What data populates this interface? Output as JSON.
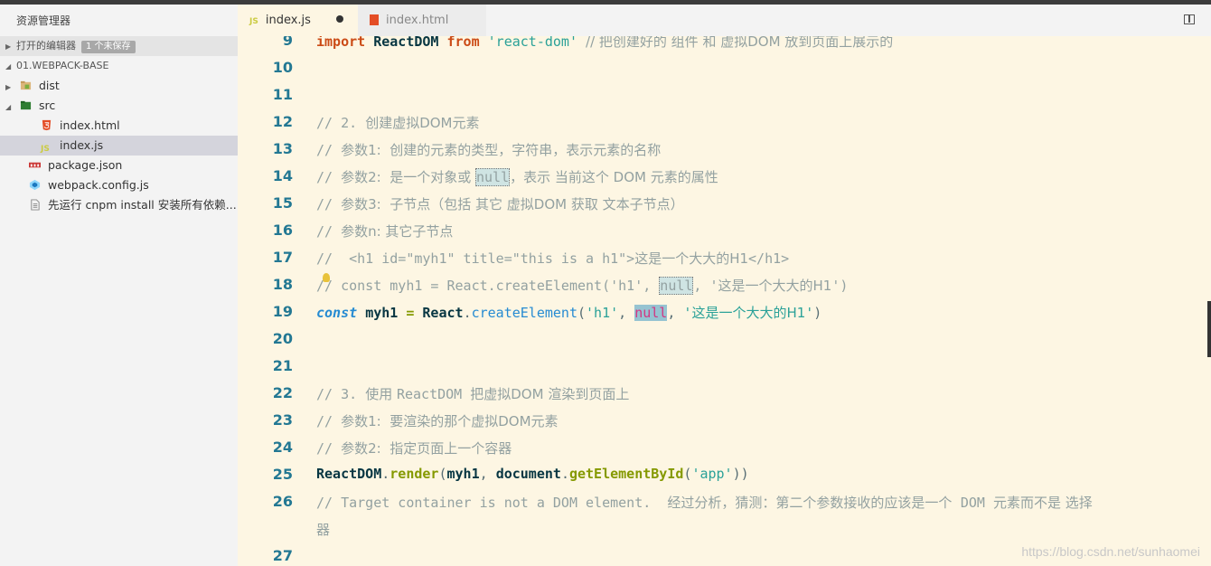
{
  "sidebar": {
    "title": "资源管理器",
    "open_editors_label": "打开的编辑器",
    "unsaved_badge": "1 个未保存",
    "project_label": "01.WEBPACK-BASE",
    "items": [
      {
        "label": "dist",
        "icon": "folder-icon"
      },
      {
        "label": "src",
        "icon": "folder-open-icon"
      },
      {
        "label": "index.html",
        "icon": "html5-icon"
      },
      {
        "label": "index.js",
        "icon": "js-icon"
      },
      {
        "label": "package.json",
        "icon": "npm-icon"
      },
      {
        "label": "webpack.config.js",
        "icon": "webpack-icon"
      },
      {
        "label": "先运行 cnpm install 安装所有依赖...",
        "icon": "file-icon"
      }
    ]
  },
  "tabs": [
    {
      "label": "index.js",
      "badge": "JS",
      "active": true,
      "modified": true
    },
    {
      "label": "index.html",
      "active": false
    }
  ],
  "editor": {
    "lines": [
      {
        "num": "9",
        "text": "import ReactDOM from 'react-dom' // 把创建好的 组件 和 虚拟DOM 放到页面上展示的"
      },
      {
        "num": "10",
        "text": ""
      },
      {
        "num": "11",
        "text": ""
      },
      {
        "num": "12",
        "text": "// 2. 创建虚拟DOM元素"
      },
      {
        "num": "13",
        "text": "// 参数1:  创建的元素的类型，字符串，表示元素的名称"
      },
      {
        "num": "14",
        "text": "// 参数2:  是一个对象或 null，表示 当前这个 DOM 元素的属性"
      },
      {
        "num": "15",
        "text": "// 参数3:  子节点（包括 其它 虚拟DOM 获取 文本子节点）"
      },
      {
        "num": "16",
        "text": "// 参数n: 其它子节点"
      },
      {
        "num": "17",
        "text": "//  <h1 id=\"myh1\" title=\"this is a h1\">这是一个大大的H1</h1>"
      },
      {
        "num": "18",
        "text": "// const myh1 = React.createElement('h1', null, '这是一个大大的H1')"
      },
      {
        "num": "19",
        "text": "const myh1 = React.createElement('h1', null, '这是一个大大的H1')"
      },
      {
        "num": "20",
        "text": ""
      },
      {
        "num": "21",
        "text": ""
      },
      {
        "num": "22",
        "text": "// 3. 使用 ReactDOM 把虚拟DOM 渲染到页面上"
      },
      {
        "num": "23",
        "text": "// 参数1:  要渲染的那个虚拟DOM元素"
      },
      {
        "num": "24",
        "text": "// 参数2:  指定页面上一个容器"
      },
      {
        "num": "25",
        "text": "ReactDOM.render(myh1, document.getElementById('app'))"
      },
      {
        "num": "26",
        "text": "// Target container is not a DOM element.  经过分析，猜测：第二个参数接收的应该是一个  DOM 元素而不是 选择"
      },
      {
        "num": "",
        "text": "器"
      },
      {
        "num": "27",
        "text": ""
      }
    ]
  },
  "watermark": "https://blog.csdn.net/sunhaomei"
}
